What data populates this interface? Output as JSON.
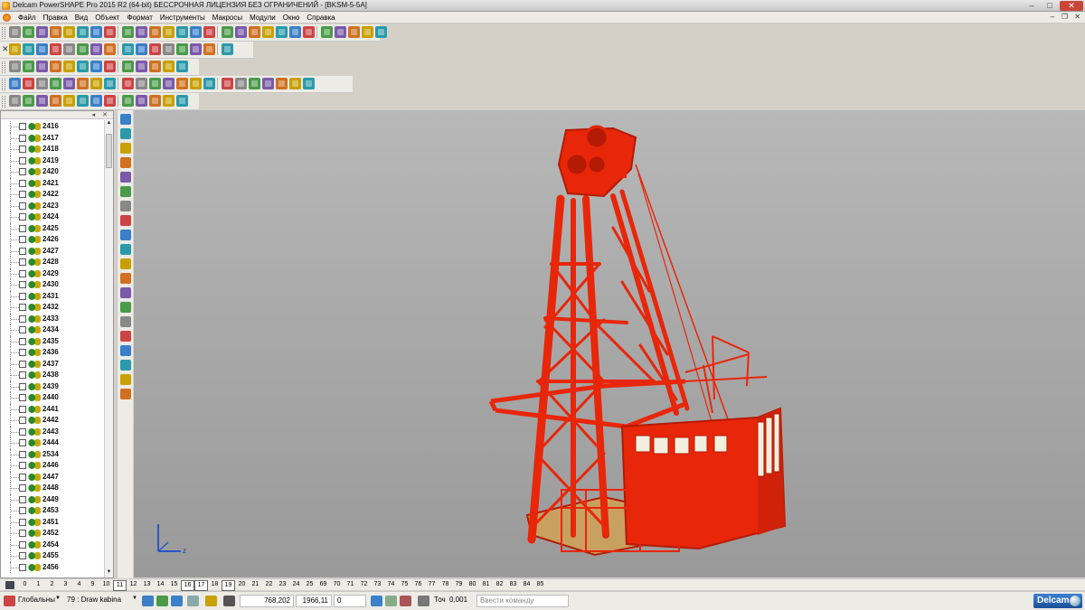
{
  "window": {
    "title": "Delcam PowerSHAPE Pro 2015 R2 (64-bit) БЕССРОЧНАЯ ЛИЦЕНЗИЯ БЕЗ ОГРАНИЧЕНИЙ - [BKSM-5-5A]",
    "min_glyph": "–",
    "max_glyph": "□",
    "close_glyph": "✕"
  },
  "menu": {
    "items": [
      "Файл",
      "Правка",
      "Вид",
      "Объект",
      "Формат",
      "Инструменты",
      "Макросы",
      "Модули",
      "Окно",
      "Справка"
    ],
    "mdi_min": "–",
    "mdi_restore": "❐",
    "mdi_close": "✕"
  },
  "toolbar_close_glyph": "✕",
  "tree": {
    "items": [
      "2416",
      "2417",
      "2418",
      "2419",
      "2420",
      "2421",
      "2422",
      "2423",
      "2424",
      "2425",
      "2426",
      "2427",
      "2428",
      "2429",
      "2430",
      "2431",
      "2432",
      "2433",
      "2434",
      "2435",
      "2436",
      "2437",
      "2438",
      "2439",
      "2440",
      "2441",
      "2442",
      "2443",
      "2444",
      "2534",
      "2446",
      "2447",
      "2448",
      "2449",
      "2453",
      "2451",
      "2452",
      "2454",
      "2455",
      "2456"
    ],
    "header_buttons": "◂ ✕",
    "scroll_up": "▲",
    "scroll_down": "▼"
  },
  "axis": {
    "x_label": "z"
  },
  "levels": {
    "tabs": [
      "0",
      "1",
      "2",
      "3",
      "4",
      "9",
      "10",
      "11",
      "12",
      "13",
      "14",
      "15",
      "16",
      "17",
      "18",
      "19",
      "20",
      "21",
      "22",
      "23",
      "24",
      "25",
      "69",
      "70",
      "71",
      "72",
      "73",
      "74",
      "75",
      "76",
      "77",
      "78",
      "79",
      "80",
      "81",
      "82",
      "83",
      "84",
      "85"
    ],
    "active": [
      "11",
      "16",
      "17",
      "19"
    ]
  },
  "status": {
    "workplane": "Глобальны",
    "workplane_arrow": "▼",
    "level": "79 : Draw kabina",
    "level_arrow": "▼",
    "x": "768,202",
    "y": "1966,11",
    "z": "0",
    "tolerance_label": "Точ",
    "tolerance_value": "0,001",
    "command_placeholder": "Ввести команду",
    "brand": "Delcam"
  },
  "colors": {
    "model": "#e8260a",
    "model_dark": "#b51a04",
    "floor": "#c8a060",
    "glass": "#f2efe0"
  }
}
